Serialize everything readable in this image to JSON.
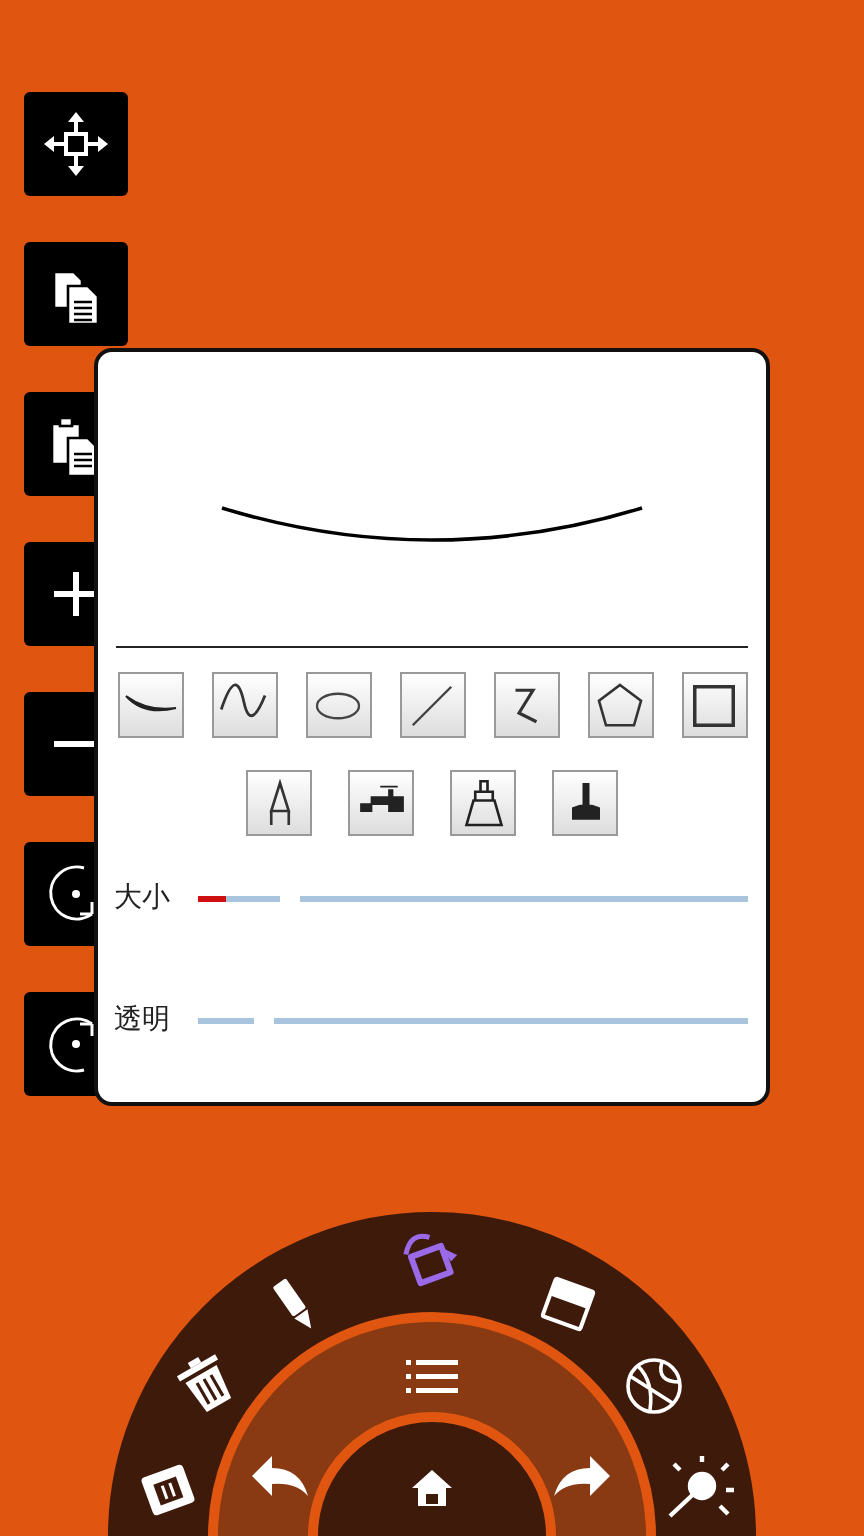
{
  "pen_panel": {
    "sliders": [
      {
        "label": "大小",
        "level": 0.05
      },
      {
        "label": "透明",
        "level": 0
      }
    ]
  },
  "radial_menu": {
    "outer_items": [
      {
        "selected": false
      },
      {
        "selected": false
      },
      {
        "selected": false
      },
      {
        "selected": true
      },
      {
        "selected": false
      },
      {
        "selected": false
      },
      {
        "selected": false
      }
    ]
  }
}
